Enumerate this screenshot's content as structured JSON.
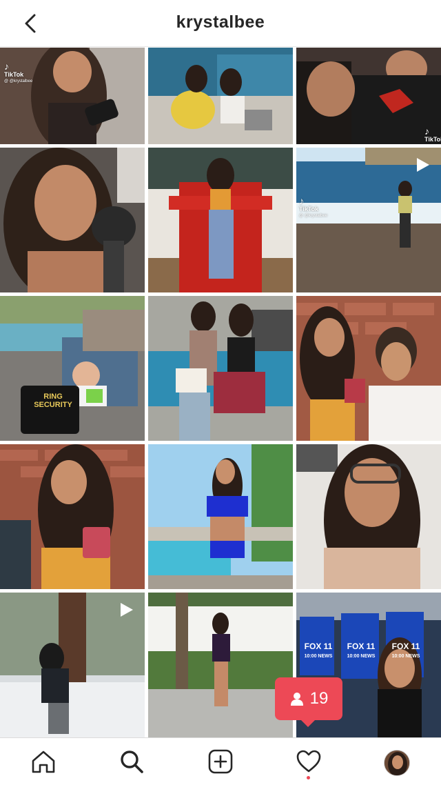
{
  "header": {
    "username": "krystalbee",
    "back_icon": "chevron-left-icon"
  },
  "grid": {
    "tiles": [
      {
        "tiktok": true,
        "tiktok_text": "TikTok",
        "tiktok_handle": "@ @krystalbee",
        "play": false
      },
      {
        "tiktok": false,
        "play": false
      },
      {
        "tiktok": true,
        "tiktok_text": "TikTok",
        "tiktok_handle": "",
        "play": false
      },
      {
        "tiktok": false,
        "play": false
      },
      {
        "tiktok": false,
        "play": false
      },
      {
        "tiktok": true,
        "tiktok_text": "TikTok",
        "tiktok_handle": "@ @krystalbee",
        "play": true
      },
      {
        "tiktok": false,
        "play": false
      },
      {
        "tiktok": false,
        "play": false
      },
      {
        "tiktok": false,
        "play": false
      },
      {
        "tiktok": false,
        "play": false
      },
      {
        "tiktok": false,
        "play": false
      },
      {
        "tiktok": false,
        "play": false
      },
      {
        "tiktok": false,
        "play": true
      },
      {
        "tiktok": false,
        "play": false
      },
      {
        "tiktok": false,
        "play": false
      }
    ],
    "signs": {
      "ring_line1": "RING",
      "ring_line2": "SECURITY",
      "fox_line1": "FOX 11",
      "fox_line2": "10:00 NEWS"
    }
  },
  "notification": {
    "count": "19",
    "icon": "person-icon",
    "color": "#ed4956"
  },
  "bottom_nav": {
    "items": [
      "home-icon",
      "search-icon",
      "new-post-icon",
      "activity-icon",
      "profile-avatar"
    ]
  }
}
